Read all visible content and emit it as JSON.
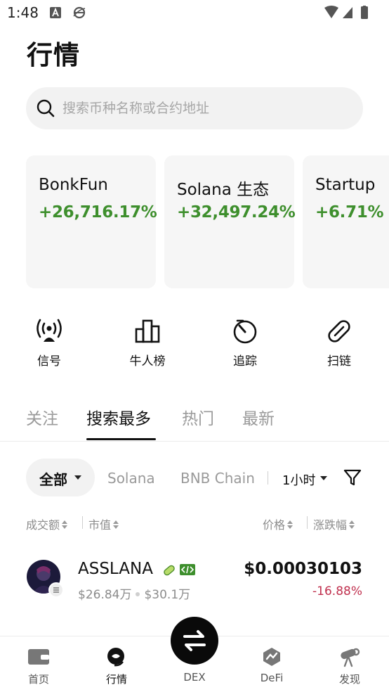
{
  "status_bar": {
    "time": "1:48"
  },
  "header": {
    "title": "行情"
  },
  "search": {
    "placeholder": "搜索币种名称或合约地址"
  },
  "categories": [
    {
      "name": "BonkFun",
      "change": "+26,716.17%"
    },
    {
      "name": "Solana 生态",
      "change": "+32,497.24%"
    },
    {
      "name": "Startup",
      "change": "+6.71%"
    }
  ],
  "tools": [
    {
      "label": "信号",
      "icon": "signal-icon"
    },
    {
      "label": "牛人榜",
      "icon": "leaderboard-icon"
    },
    {
      "label": "追踪",
      "icon": "tracking-icon"
    },
    {
      "label": "扫链",
      "icon": "scan-chain-icon"
    }
  ],
  "tabs": [
    {
      "label": "关注",
      "active": false
    },
    {
      "label": "搜索最多",
      "active": true
    },
    {
      "label": "热门",
      "active": false
    },
    {
      "label": "最新",
      "active": false
    }
  ],
  "filters": {
    "selected": "全部",
    "chains": [
      "Solana",
      "BNB Chain"
    ],
    "timeframe": "1小时"
  },
  "columns": {
    "volume": "成交额",
    "market_cap": "市值",
    "price": "价格",
    "change": "涨跌幅"
  },
  "tokens": [
    {
      "symbol": "ASSLANA",
      "volume": "$26.84万",
      "market_cap": "$30.1万",
      "price": "$0.00030103",
      "change": "-16.88%"
    }
  ],
  "bottom_nav": {
    "items": [
      {
        "label": "首页",
        "icon": "wallet-icon",
        "active": false
      },
      {
        "label": "行情",
        "icon": "market-icon",
        "active": true
      },
      {
        "label": "DEX",
        "icon": "swap-icon",
        "active": false
      },
      {
        "label": "DeFi",
        "icon": "defi-icon",
        "active": false
      },
      {
        "label": "发现",
        "icon": "discover-icon",
        "active": false
      }
    ]
  },
  "colors": {
    "positive": "#3e8f2d",
    "negative": "#c0304e",
    "card_bg": "#f6f6f6",
    "muted_text": "#9a9a9a"
  }
}
